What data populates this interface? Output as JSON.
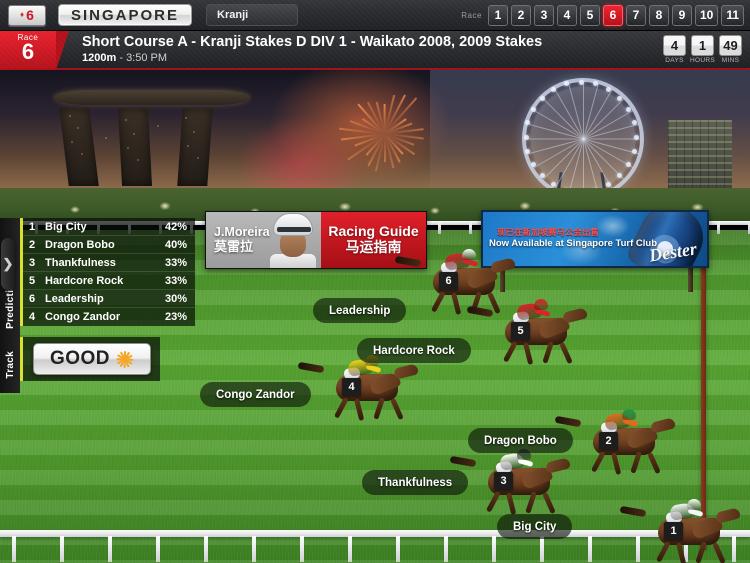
{
  "topbar": {
    "meet_badge": {
      "icon": "jockey-silk-icon",
      "number": "6"
    },
    "country": "SINGAPORE",
    "venue": "Kranji",
    "race_label": "Race",
    "race_tabs": [
      "1",
      "2",
      "3",
      "4",
      "5",
      "6",
      "7",
      "8",
      "9",
      "10",
      "11"
    ],
    "active_race": "6"
  },
  "race_header": {
    "flag_label": "Race",
    "flag_number": "6",
    "title": "Short Course A - Kranji Stakes D  DIV 1 - Waikato 2008, 2009 Stakes",
    "distance": "1200m",
    "separator": "-",
    "post_time": "3:50 PM",
    "countdown": [
      {
        "value": "4",
        "label": "DAYS"
      },
      {
        "value": "1",
        "label": "HOURS"
      },
      {
        "value": "49",
        "label": "MINS"
      }
    ]
  },
  "jockey_panel": {
    "name_en": "J.Moreira",
    "name_cn": "莫雷拉",
    "guide_en": "Racing Guide",
    "guide_cn": "马运指南"
  },
  "billboard": {
    "text_cn": "现已在新加坡赛马公会出售",
    "text_en": "Now Available at Singapore Turf Club",
    "brand": "Dester"
  },
  "prediction": {
    "tab_label": "Prediction",
    "collapse_icon": "chevron-right-icon",
    "rows": [
      {
        "number": "1",
        "horse": "Big City",
        "percent": "42%"
      },
      {
        "number": "2",
        "horse": "Dragon Bobo",
        "percent": "40%"
      },
      {
        "number": "3",
        "horse": "Thankfulness",
        "percent": "33%"
      },
      {
        "number": "5",
        "horse": "Hardcore Rock",
        "percent": "33%"
      },
      {
        "number": "6",
        "horse": "Leadership",
        "percent": "30%"
      },
      {
        "number": "4",
        "horse": "Congo Zandor",
        "percent": "23%"
      }
    ]
  },
  "track_condition": {
    "tab_label": "Track",
    "value": "GOOD",
    "weather_icon": "sun-icon"
  },
  "runners": [
    {
      "number": "6",
      "name": "Leadership",
      "silk": "#d8232a",
      "cap": "#ffffff"
    },
    {
      "number": "5",
      "name": "Hardcore Rock",
      "silk": "#e02127",
      "cap": "#e02127"
    },
    {
      "number": "4",
      "name": "Congo Zandor",
      "silk": "#f2d01a",
      "cap": "#f2d01a"
    },
    {
      "number": "2",
      "name": "Dragon Bobo",
      "silk": "#e8671c",
      "cap": "#1e9b4b"
    },
    {
      "number": "3",
      "name": "Thankfulness",
      "silk": "#ffffff",
      "cap": "#3a3f4a"
    },
    {
      "number": "1",
      "name": "Big City",
      "silk": "#f4f6f8",
      "cap": "#ffffff"
    }
  ],
  "colors": {
    "accent_red": "#e02029",
    "accent_yellow": "#d8e132",
    "turf_green": "#59a832"
  }
}
